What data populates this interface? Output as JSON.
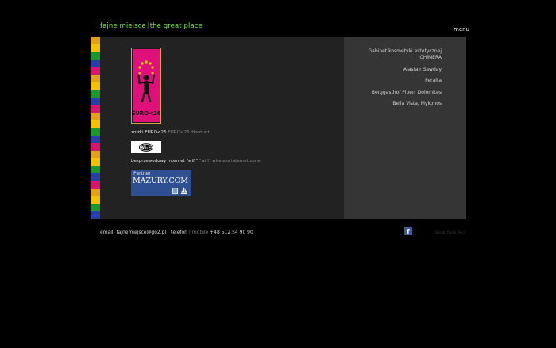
{
  "header": {
    "brand": "fajne miejsce",
    "separator": "|",
    "tagline": "the great place",
    "menu_label": "menu"
  },
  "colors": {
    "brand_green": "#7be63a",
    "stripe": [
      "#e3a11b",
      "#f2c200",
      "#1e9630",
      "#2a3ea8",
      "#d8156e",
      "#e3a11b",
      "#f2c200",
      "#1e9630",
      "#2a3ea8",
      "#d8156e",
      "#e3a11b",
      "#f2c200",
      "#1e9630",
      "#2a3ea8",
      "#d8156e",
      "#e3a11b",
      "#f2c200",
      "#1e9630",
      "#2a3ea8",
      "#d8156e",
      "#e3a11b",
      "#f2c200",
      "#1e9630",
      "#2a3ea8"
    ]
  },
  "main": {
    "euro_badge_label": "EURO<26",
    "euro_text_pl": "zniżki EURO<26",
    "euro_text_en": "EURO<26 discount",
    "wifi_logo_label": "Wi-Fi",
    "wifi_text_pl": "bezprzewodowy internet \"wifi\"",
    "wifi_text_en": "\"wifi\" wireless internet zone",
    "partner_top": "Partner",
    "partner_main": "MAZURY.COM"
  },
  "sidebar": {
    "items": [
      {
        "label": "Gabinet kosmetyki estetycznej CHIMERA"
      },
      {
        "label": "Alastair Sawday"
      },
      {
        "label": "Peralta"
      },
      {
        "label": "Berggasthof Ploerr Dolomites"
      },
      {
        "label": "Bella Vista, Mykonos"
      }
    ]
  },
  "footer": {
    "email_label": "email:",
    "email_value": "fajnemiejsce@go2.pl",
    "phone_label": "telefon",
    "phone_sep": "|",
    "mobile_label": "mobile",
    "phone_value": "+48 512 54 90 90",
    "facebook_glyph": "f",
    "credit": "Design Radio Pieci"
  }
}
